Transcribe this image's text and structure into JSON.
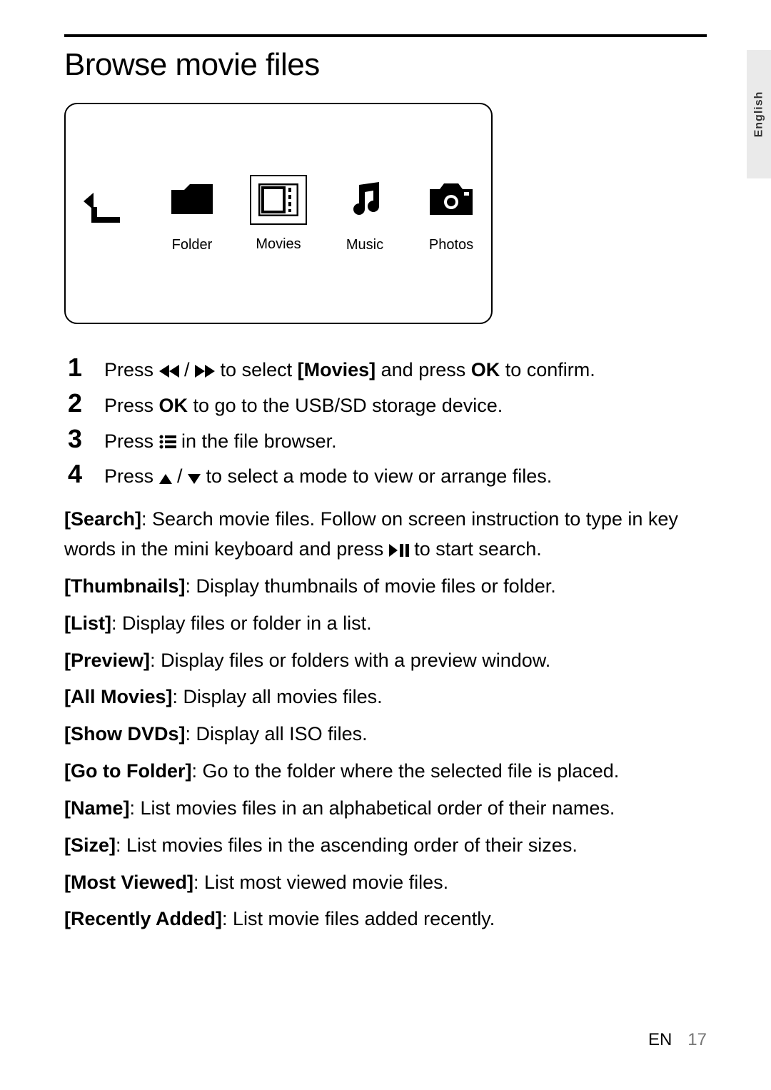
{
  "header": {
    "title": "Browse movie files",
    "langTab": "English"
  },
  "categories": {
    "back": "",
    "folder": "Folder",
    "movies": "Movies",
    "music": "Music",
    "photos": "Photos"
  },
  "steps": {
    "s1": {
      "num": "1",
      "pre": "Press ",
      "mid": " to select ",
      "bold1": "[Movies]",
      "mid2": " and press ",
      "bold2": "OK",
      "post": " to confirm."
    },
    "s2": {
      "num": "2",
      "pre": "Press ",
      "bold1": "OK",
      "post": " to go to the USB/SD storage device."
    },
    "s3": {
      "num": "3",
      "pre": "Press ",
      "post": " in the file browser."
    },
    "s4": {
      "num": "4",
      "pre": "Press ",
      "post": " to select a mode to view or arrange files."
    }
  },
  "options": {
    "search": {
      "label": "[Search]",
      "desc1": ": Search movie files. Follow on screen instruction to type in key words in the mini keyboard and press ",
      "desc2": " to start search."
    },
    "thumbnails": {
      "label": "[Thumbnails]",
      "desc": ": Display thumbnails of movie files or folder."
    },
    "list": {
      "label": "[List]",
      "desc": ": Display files or folder in a list."
    },
    "preview": {
      "label": "[Preview]",
      "desc": ": Display files or folders with a preview window."
    },
    "allmovies": {
      "label": "[All Movies]",
      "desc": ": Display all movies files."
    },
    "showdvds": {
      "label": "[Show DVDs]",
      "desc": ": Display all ISO files."
    },
    "gotofolder": {
      "label": "[Go to Folder]",
      "desc": ": Go to the folder where the selected file is placed."
    },
    "name": {
      "label": "[Name]",
      "desc": ": List movies files in an alphabetical order of their names."
    },
    "size": {
      "label": "[Size]",
      "desc": ": List movies files in the ascending order of their sizes."
    },
    "mostviewed": {
      "label": "[Most Viewed]",
      "desc": ": List most viewed movie files."
    },
    "recentlyadded": {
      "label": "[Recently Added]",
      "desc": ": List movie files added recently."
    }
  },
  "footer": {
    "lang": "EN",
    "page": "17"
  }
}
